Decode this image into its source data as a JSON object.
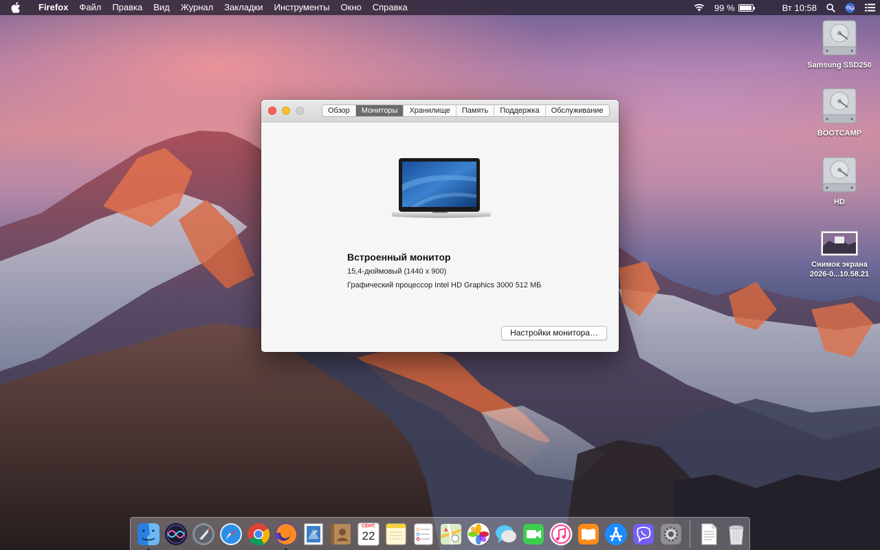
{
  "menubar": {
    "app_name": "Firefox",
    "items": [
      "Файл",
      "Правка",
      "Вид",
      "Журнал",
      "Закладки",
      "Инструменты",
      "Окно",
      "Справка"
    ],
    "battery_percent": "99 %",
    "battery_level": 0.99,
    "clock": "Вт 10:58"
  },
  "desktop_icons": [
    {
      "label": "Samsung SSD250",
      "icon": "hard-drive-icon"
    },
    {
      "label": "BOOTCAMP",
      "icon": "hard-drive-icon"
    },
    {
      "label": "HD",
      "icon": "hard-drive-icon"
    },
    {
      "label_line1": "Снимок экрана",
      "label_line2": "2026-0...10.58.21",
      "icon": "screenshot-thumbnail"
    }
  ],
  "window": {
    "tabs": [
      "Обзор",
      "Мониторы",
      "Хранилище",
      "Память",
      "Поддержка",
      "Обслуживание"
    ],
    "active_tab": "Мониторы",
    "monitor_name": "Встроенный монитор",
    "monitor_size": "15,4-дюймовый (1440 x 900)",
    "gpu": "Графический процессор Intel HD Graphics 3000 512 МБ",
    "settings_button": "Настройки монитора…"
  },
  "dock": {
    "items": [
      {
        "name": "finder",
        "running": true
      },
      {
        "name": "siri",
        "running": false
      },
      {
        "name": "launchpad",
        "running": false
      },
      {
        "name": "safari",
        "running": false
      },
      {
        "name": "chrome",
        "running": false
      },
      {
        "name": "firefox",
        "running": true
      },
      {
        "name": "mail-stamp",
        "running": false
      },
      {
        "name": "contacts",
        "running": false
      },
      {
        "name": "calendar",
        "running": false
      },
      {
        "name": "notes",
        "running": false
      },
      {
        "name": "reminders",
        "running": false
      },
      {
        "name": "maps",
        "running": false
      },
      {
        "name": "photos",
        "running": false
      },
      {
        "name": "messages",
        "running": false
      },
      {
        "name": "facetime",
        "running": false
      },
      {
        "name": "itunes",
        "running": false
      },
      {
        "name": "ibooks",
        "running": false
      },
      {
        "name": "app-store",
        "running": false
      },
      {
        "name": "viber",
        "running": false
      },
      {
        "name": "system-preferences",
        "running": false
      },
      {
        "name": "document",
        "running": false
      },
      {
        "name": "trash",
        "running": false
      }
    ],
    "calendar_month": "СЕНТ.",
    "calendar_day": "22"
  },
  "colors": {
    "tab_active": "#6b6b6b",
    "close": "#fc5f57",
    "minimize": "#fdbc2e"
  }
}
